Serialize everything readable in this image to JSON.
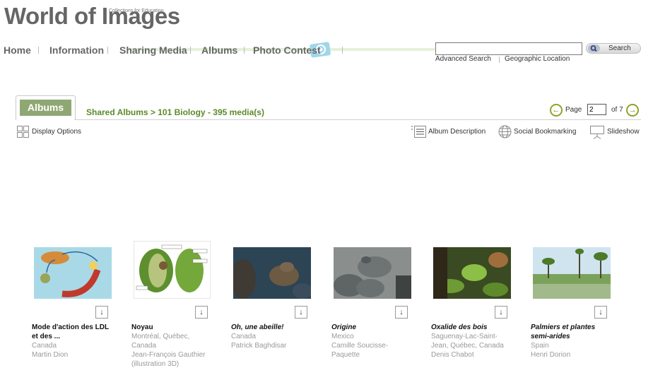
{
  "logo": {
    "title": "World of Images",
    "tagline": "Collections for Education"
  },
  "nav": {
    "items": [
      {
        "label": "Home"
      },
      {
        "label": "Information"
      },
      {
        "label": "Sharing Media"
      },
      {
        "label": "Albums"
      },
      {
        "label": "Photo Contest"
      }
    ]
  },
  "search": {
    "value": "",
    "button_label": "Search",
    "advanced_label": "Advanced Search",
    "geo_label": "Geographic Location"
  },
  "albums_tab": {
    "label": "Albums"
  },
  "breadcrumb": "Shared Albums > 101 Biology - 395 media(s)",
  "pager": {
    "page_label": "Page",
    "current_page": "2",
    "of_label": "of 7"
  },
  "toolbar": {
    "display_options": "Display Options",
    "album_description": "Album Description",
    "social_bookmarking": "Social Bookmarking",
    "slideshow": "Slideshow"
  },
  "media": [
    {
      "title_lines": [
        "Mode d'action des LDL",
        "et des ..."
      ],
      "italic": false,
      "location_lines": [
        "Canada"
      ],
      "author_lines": [
        "Martin Dion"
      ]
    },
    {
      "title_lines": [
        "Noyau"
      ],
      "italic": false,
      "location_lines": [
        "Montréal, Québec,",
        "Canada"
      ],
      "author_lines": [
        "Jean-François Gauthier",
        "(illustration 3D)"
      ]
    },
    {
      "title_lines": [
        "Oh, une abeille!"
      ],
      "italic": true,
      "location_lines": [
        "Canada"
      ],
      "author_lines": [
        "Patrick Baghdisar"
      ]
    },
    {
      "title_lines": [
        "Origine"
      ],
      "italic": true,
      "location_lines": [
        "Mexico"
      ],
      "author_lines": [
        "Camille Soucisse-",
        "Paquette"
      ]
    },
    {
      "title_lines": [
        "Oxalide des bois"
      ],
      "italic": true,
      "location_lines": [
        "Saguenay-Lac-Saint-",
        "Jean, Québec, Canada"
      ],
      "author_lines": [
        "Denis Chabot"
      ]
    },
    {
      "title_lines": [
        "Palmiers et plantes",
        "semi-arides"
      ],
      "italic": true,
      "location_lines": [
        "Spain"
      ],
      "author_lines": [
        "Henri Dorion"
      ]
    }
  ],
  "colors": {
    "accent_green": "#5c8a2a",
    "tab_green": "#8fa873",
    "pager_green": "#8fa32c"
  }
}
